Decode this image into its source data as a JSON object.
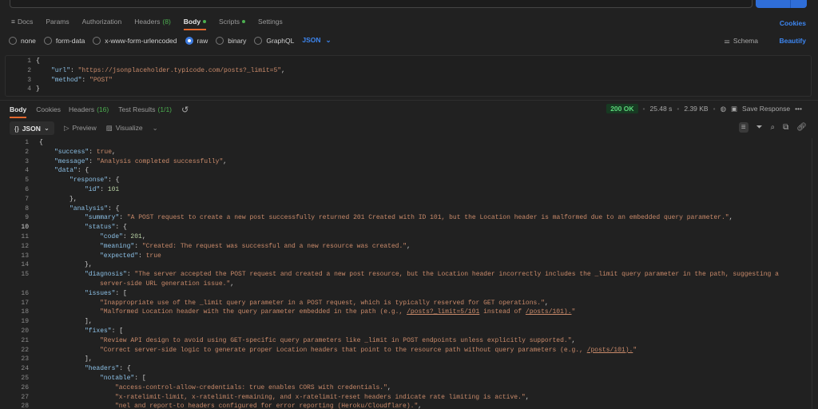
{
  "request_tabs": {
    "docs": "Docs",
    "params": "Params",
    "authorization": "Authorization",
    "headers": "Headers",
    "headers_count": "(8)",
    "body": "Body",
    "scripts": "Scripts",
    "settings": "Settings",
    "cookies": "Cookies"
  },
  "body_types": {
    "none": "none",
    "form_data": "form-data",
    "urlencoded": "x-www-form-urlencoded",
    "raw": "raw",
    "binary": "binary",
    "graphql": "GraphQL",
    "format": "JSON",
    "schema": "Schema",
    "beautify": "Beautify",
    "selected": "raw"
  },
  "request_body": [
    {
      "n": "1",
      "t": [
        [
          "p",
          "{"
        ]
      ]
    },
    {
      "n": "2",
      "i": 1,
      "t": [
        [
          "k",
          "\"url\""
        ],
        [
          "p",
          ": "
        ],
        [
          "s",
          "\"https://jsonplaceholder.typicode.com/posts?_limit=5\""
        ],
        [
          "p",
          ","
        ]
      ]
    },
    {
      "n": "3",
      "i": 1,
      "t": [
        [
          "k",
          "\"method\""
        ],
        [
          "p",
          ": "
        ],
        [
          "s",
          "\"POST\""
        ]
      ]
    },
    {
      "n": "4",
      "t": [
        [
          "p",
          "}"
        ]
      ]
    }
  ],
  "response_tabs": {
    "body": "Body",
    "cookies": "Cookies",
    "headers": "Headers",
    "headers_count": "(16)",
    "tests": "Test Results",
    "tests_count": "(1/1)"
  },
  "response_meta": {
    "status": "200 OK",
    "time": "25.48 s",
    "size": "2.39 KB",
    "save": "Save Response"
  },
  "response_toolbar": {
    "format": "JSON",
    "preview": "Preview",
    "visualize": "Visualize"
  },
  "colors": {
    "accent": "#e1672e",
    "primary": "#2f6ed8",
    "success": "#5bd67a"
  },
  "response_body": [
    {
      "n": "1",
      "t": [
        [
          "p",
          "{"
        ]
      ]
    },
    {
      "n": "2",
      "i": 1,
      "t": [
        [
          "k",
          "\"success\""
        ],
        [
          "p",
          ": "
        ],
        [
          "b",
          "true"
        ],
        [
          "p",
          ","
        ]
      ]
    },
    {
      "n": "3",
      "i": 1,
      "t": [
        [
          "k",
          "\"message\""
        ],
        [
          "p",
          ": "
        ],
        [
          "s",
          "\"Analysis completed successfully\""
        ],
        [
          "p",
          ","
        ]
      ]
    },
    {
      "n": "4",
      "i": 1,
      "t": [
        [
          "k",
          "\"data\""
        ],
        [
          "p",
          ": {"
        ]
      ]
    },
    {
      "n": "5",
      "i": 2,
      "t": [
        [
          "k",
          "\"response\""
        ],
        [
          "p",
          ": {"
        ]
      ]
    },
    {
      "n": "6",
      "i": 3,
      "t": [
        [
          "k",
          "\"id\""
        ],
        [
          "p",
          ": "
        ],
        [
          "n",
          "101"
        ]
      ]
    },
    {
      "n": "7",
      "i": 2,
      "t": [
        [
          "p",
          "},"
        ]
      ]
    },
    {
      "n": "8",
      "i": 2,
      "t": [
        [
          "k",
          "\"analysis\""
        ],
        [
          "p",
          ": {"
        ]
      ]
    },
    {
      "n": "9",
      "i": 3,
      "t": [
        [
          "k",
          "\"summary\""
        ],
        [
          "p",
          ": "
        ],
        [
          "s",
          "\"A POST request to create a new post successfully returned 201 Created with ID 101, but the Location header is malformed due to an embedded query parameter.\""
        ],
        [
          "p",
          ","
        ]
      ]
    },
    {
      "n": "10",
      "i": 3,
      "cur": true,
      "t": [
        [
          "k",
          "\"status\""
        ],
        [
          "p",
          ": {"
        ]
      ]
    },
    {
      "n": "11",
      "i": 4,
      "t": [
        [
          "k",
          "\"code\""
        ],
        [
          "p",
          ": "
        ],
        [
          "n",
          "201"
        ],
        [
          "p",
          ","
        ]
      ]
    },
    {
      "n": "12",
      "i": 4,
      "t": [
        [
          "k",
          "\"meaning\""
        ],
        [
          "p",
          ": "
        ],
        [
          "s",
          "\"Created: The request was successful and a new resource was created.\""
        ],
        [
          "p",
          ","
        ]
      ]
    },
    {
      "n": "13",
      "i": 4,
      "t": [
        [
          "k",
          "\"expected\""
        ],
        [
          "p",
          ": "
        ],
        [
          "b",
          "true"
        ]
      ]
    },
    {
      "n": "14",
      "i": 3,
      "t": [
        [
          "p",
          "},"
        ]
      ]
    },
    {
      "n": "15",
      "i": 3,
      "t": [
        [
          "k",
          "\"diagnosis\""
        ],
        [
          "p",
          ": "
        ],
        [
          "s",
          "\"The server accepted the POST request and created a new post resource, but the Location header incorrectly includes the _limit query parameter in the path, suggesting a"
        ]
      ]
    },
    {
      "n": "",
      "i": 4,
      "t": [
        [
          "s",
          "server-side URL generation issue.\""
        ],
        [
          "p",
          ","
        ]
      ]
    },
    {
      "n": "16",
      "i": 3,
      "t": [
        [
          "k",
          "\"issues\""
        ],
        [
          "p",
          ": ["
        ]
      ]
    },
    {
      "n": "17",
      "i": 4,
      "t": [
        [
          "s",
          "\"Inappropriate use of the _limit query parameter in a POST request, which is typically reserved for GET operations.\""
        ],
        [
          "p",
          ","
        ]
      ]
    },
    {
      "n": "18",
      "i": 4,
      "t": [
        [
          "s",
          "\"Malformed Location header with the query parameter embedded in the path (e.g., "
        ],
        [
          "l",
          "/posts?_limit=5/101"
        ],
        [
          "s",
          " instead of "
        ],
        [
          "l",
          "/posts/101)."
        ],
        [
          "s",
          "\""
        ]
      ]
    },
    {
      "n": "19",
      "i": 3,
      "t": [
        [
          "p",
          "],"
        ]
      ]
    },
    {
      "n": "20",
      "i": 3,
      "t": [
        [
          "k",
          "\"fixes\""
        ],
        [
          "p",
          ": ["
        ]
      ]
    },
    {
      "n": "21",
      "i": 4,
      "t": [
        [
          "s",
          "\"Review API design to avoid using GET-specific query parameters like _limit in POST endpoints unless explicitly supported.\""
        ],
        [
          "p",
          ","
        ]
      ]
    },
    {
      "n": "22",
      "i": 4,
      "t": [
        [
          "s",
          "\"Correct server-side logic to generate proper Location headers that point to the resource path without query parameters (e.g., "
        ],
        [
          "l",
          "/posts/101)."
        ],
        [
          "s",
          "\""
        ]
      ]
    },
    {
      "n": "23",
      "i": 3,
      "t": [
        [
          "p",
          "],"
        ]
      ]
    },
    {
      "n": "24",
      "i": 3,
      "t": [
        [
          "k",
          "\"headers\""
        ],
        [
          "p",
          ": {"
        ]
      ]
    },
    {
      "n": "25",
      "i": 4,
      "t": [
        [
          "k",
          "\"notable\""
        ],
        [
          "p",
          ": ["
        ]
      ]
    },
    {
      "n": "26",
      "i": 5,
      "t": [
        [
          "s",
          "\"access-control-allow-credentials: true enables CORS with credentials.\""
        ],
        [
          "p",
          ","
        ]
      ]
    },
    {
      "n": "27",
      "i": 5,
      "t": [
        [
          "s",
          "\"x-ratelimit-limit, x-ratelimit-remaining, and x-ratelimit-reset headers indicate rate limiting is active.\""
        ],
        [
          "p",
          ","
        ]
      ]
    },
    {
      "n": "28",
      "i": 5,
      "t": [
        [
          "s",
          "\"nel and report-to headers configured for error reporting (Heroku/Cloudflare).\""
        ],
        [
          "p",
          ","
        ]
      ]
    }
  ]
}
